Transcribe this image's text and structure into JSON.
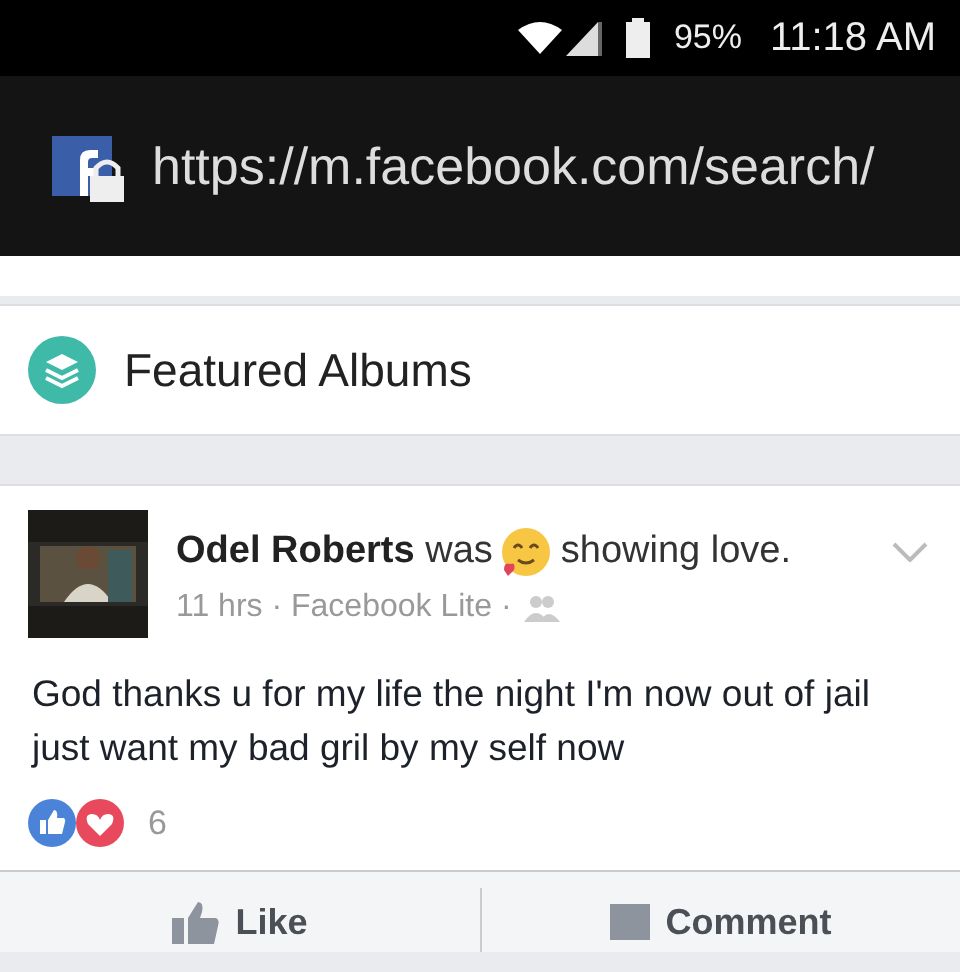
{
  "status_bar": {
    "battery": "95%",
    "time": "11:18 AM"
  },
  "address_bar": {
    "url": "https://m.facebook.com/search/"
  },
  "featured": {
    "title": "Featured Albums"
  },
  "post": {
    "author": "Odel Roberts",
    "action_before": "was",
    "action_after": "showing love.",
    "meta": "11 hrs · Facebook Lite ·",
    "text": "God thanks u for my life the night I'm now out of jail just want my bad gril by my self now",
    "reactions_count": "6"
  },
  "actions": [
    {
      "label": "Like",
      "kind": "like"
    },
    {
      "label": "Comment",
      "kind": "comment"
    }
  ]
}
